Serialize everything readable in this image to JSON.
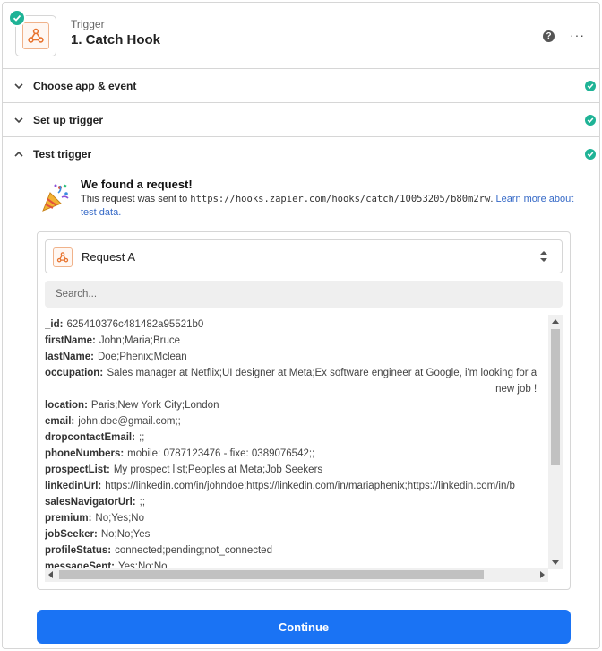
{
  "header": {
    "step_type": "Trigger",
    "step_title": "1. Catch Hook",
    "app_icon": "webhook-icon",
    "help_icon": "question-icon",
    "more_icon": "ellipsis-icon",
    "more_glyph": "···"
  },
  "sections": {
    "choose_app": "Choose app & event",
    "setup_trigger": "Set up trigger",
    "test_trigger": "Test trigger"
  },
  "found": {
    "title": "We found a request!",
    "desc_prefix": "This request was sent to ",
    "url": "https://hooks.zapier.com/hooks/catch/10053205/b80m2rw",
    "desc_suffix": ". ",
    "learn_more": "Learn more about test data."
  },
  "request": {
    "selected": "Request A",
    "search_placeholder": "Search...",
    "fields": [
      {
        "key": "_id:",
        "value": "625410376c481482a95521b0"
      },
      {
        "key": "firstName:",
        "value": "John;Maria;Bruce"
      },
      {
        "key": "lastName:",
        "value": "Doe;Phenix;Mclean"
      },
      {
        "key": "occupation:",
        "value": "Sales manager at Netflix;UI designer at Meta;Ex software engineer at Google, i'm looking for a new job !"
      },
      {
        "key": "location:",
        "value": "Paris;New York City;London"
      },
      {
        "key": "email:",
        "value": "john.doe@gmail.com;;"
      },
      {
        "key": "dropcontactEmail:",
        "value": ";;"
      },
      {
        "key": "phoneNumbers:",
        "value": "mobile: 0787123476 - fixe: 0389076542;;"
      },
      {
        "key": "prospectList:",
        "value": "My prospect list;Peoples at Meta;Job Seekers"
      },
      {
        "key": "linkedinUrl:",
        "value": "https://linkedin.com/in/johndoe;https://linkedin.com/in/mariaphenix;https://linkedin.com/in/b"
      },
      {
        "key": "salesNavigatorUrl:",
        "value": ";;"
      },
      {
        "key": "premium:",
        "value": "No;Yes;No"
      },
      {
        "key": "jobSeeker:",
        "value": "No;No;Yes"
      },
      {
        "key": "profileStatus:",
        "value": "connected;pending;not_connected"
      },
      {
        "key": "messageSent:",
        "value": "Yes;No;No"
      }
    ]
  },
  "continue_label": "Continue",
  "colors": {
    "accent": "#1a73f4",
    "success": "#1fb396",
    "link": "#3569c7",
    "app_orange": "#e8742f"
  }
}
